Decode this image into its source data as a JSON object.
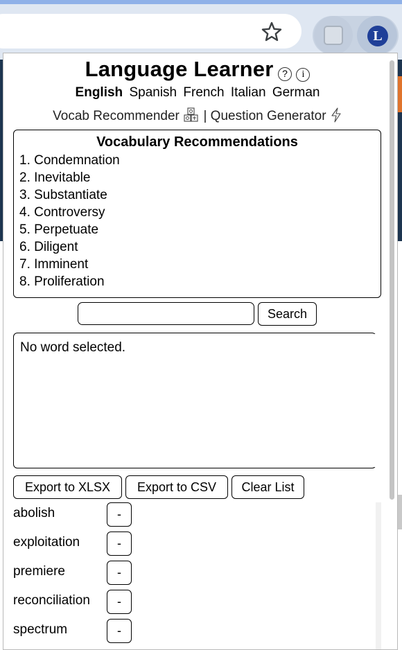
{
  "extension": {
    "icon_letter": "L"
  },
  "popup": {
    "title": "Language Learner",
    "help_icon": "?",
    "info_icon": "i",
    "languages": [
      "English",
      "Spanish",
      "French",
      "Italian",
      "German"
    ],
    "active_language": "English",
    "nav": {
      "vocab": "Vocab Recommender",
      "separator": "|",
      "questions": "Question Generator"
    },
    "vocab_box": {
      "title": "Vocabulary Recommendations",
      "items": [
        "1. Condemnation",
        "2. Inevitable",
        "3. Substantiate",
        "4. Controversy",
        "5. Perpetuate",
        "6. Diligent",
        "7. Imminent",
        "8. Proliferation"
      ]
    },
    "search": {
      "value": "",
      "button_label": "Search"
    },
    "detail_text": "No word selected.",
    "buttons": {
      "export_xlsx": "Export to XLSX",
      "export_csv": "Export to CSV",
      "clear_list": "Clear List"
    },
    "word_list": [
      {
        "word": "abolish",
        "remove": "-"
      },
      {
        "word": "exploitation",
        "remove": "-"
      },
      {
        "word": "premiere",
        "remove": "-"
      },
      {
        "word": "reconciliation",
        "remove": "-"
      },
      {
        "word": "spectrum",
        "remove": "-"
      }
    ]
  },
  "colors": {
    "toolbar": "#dfe7f2",
    "extension_blue": "#1f3f98",
    "page_dark": "#1d3550",
    "page_orange": "#e0742c"
  },
  "icons": {
    "star": "star-icon",
    "pocket": "pocket-icon",
    "help": "question-circle-icon",
    "info": "info-circle-icon",
    "blocks": "alphabet-blocks-icon",
    "bolt": "lightning-icon"
  }
}
